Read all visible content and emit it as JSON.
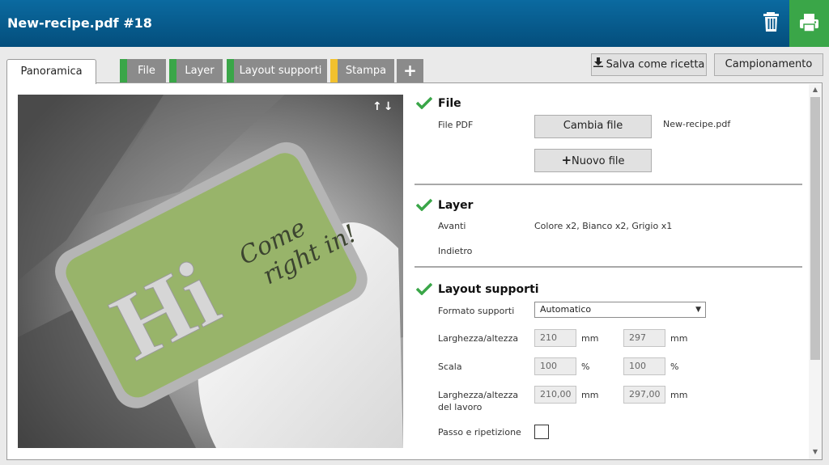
{
  "header": {
    "title": "New-recipe.pdf #18",
    "trash_icon": "trash-icon",
    "print_icon": "printer-icon",
    "accent_color": "#3aa648"
  },
  "tabs": [
    {
      "label": "Panoramica",
      "active": true
    },
    {
      "label": "File",
      "marker_color": "#3aa648"
    },
    {
      "label": "Layer",
      "marker_color": "#3aa648"
    },
    {
      "label": "Layout supporti",
      "marker_color": "#3aa648"
    },
    {
      "label": "Stampa",
      "marker_color": "#f2c12e"
    },
    {
      "label": "+"
    }
  ],
  "toolbar": {
    "save_recipe_label": "Salva come ricetta",
    "sampling_label": "Campionamento"
  },
  "preview": {
    "card_text_main": "Hi",
    "card_text_script_line1": "Come",
    "card_text_script_line2": "right in!",
    "arrows": "↑↓"
  },
  "file_section": {
    "title": "File",
    "pdf_label": "File PDF",
    "change_file_button": "Cambia file",
    "filename": "New-recipe.pdf",
    "new_file_button": "Nuovo file"
  },
  "layer_section": {
    "title": "Layer",
    "front_label": "Avanti",
    "front_value": "Colore x2, Bianco x2, Grigio x1",
    "back_label": "Indietro"
  },
  "layout_section": {
    "title": "Layout supporti",
    "format_label": "Formato supporti",
    "format_value": "Automatico",
    "size_label": "Larghezza/altezza",
    "width": "210",
    "height": "297",
    "unit_mm": "mm",
    "scale_label": "Scala",
    "scale_w": "100",
    "scale_h": "100",
    "unit_pct": "%",
    "job_size_label_line1": "Larghezza/altezza",
    "job_size_label_line2": "del lavoro",
    "job_width": "210,00",
    "job_height": "297,00",
    "step_repeat_label": "Passo e ripetizione"
  }
}
